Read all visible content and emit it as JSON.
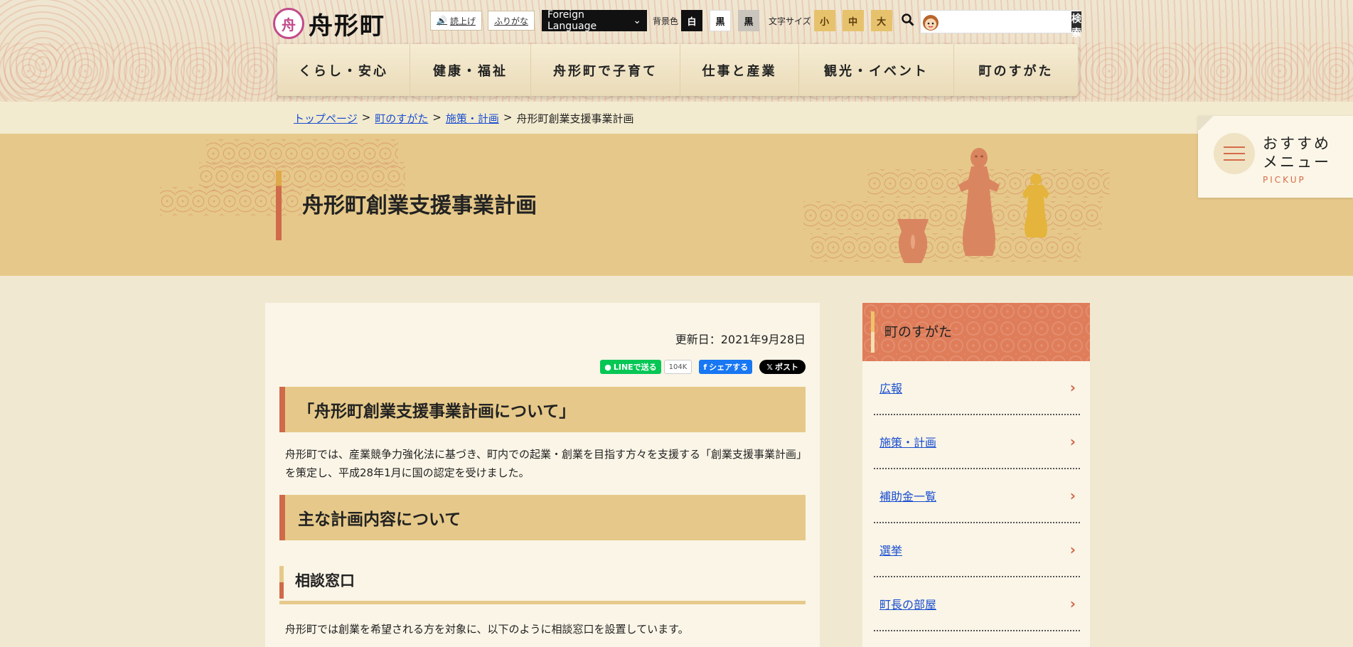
{
  "header": {
    "logo_mark": "舟",
    "logo_text": "舟形町",
    "read_aloud": "読上げ",
    "furigana": "ふりがな",
    "language_select": "Foreign Language",
    "bg_color_label": "背景色",
    "bg_options": [
      "白",
      "黒",
      "黒"
    ],
    "font_size_label": "文字サイズ",
    "font_sizes": [
      "小",
      "中",
      "大"
    ],
    "search_placeholder": "",
    "search_button": "検索"
  },
  "nav": {
    "items": [
      "くらし・安心",
      "健康・福祉",
      "舟形町で子育て",
      "仕事と産業",
      "観光・イベント",
      "町のすがた"
    ]
  },
  "breadcrumb": {
    "items": [
      "トップページ",
      "町のすがた",
      "施策・計画"
    ],
    "current": "舟形町創業支援事業計画",
    "separator": ">"
  },
  "page_title": "舟形町創業支援事業計画",
  "pickup": {
    "line1": "おすすめ",
    "line2": "メニュー",
    "sub": "PICKUP"
  },
  "article": {
    "updated": "更新日：2021年9月28日",
    "share": {
      "line": "LINEで送る",
      "count": "104K",
      "facebook": "シェアする",
      "x": "ポスト"
    },
    "h2_1": "「舟形町創業支援事業計画について」",
    "para_1": "舟形町では、産業競争力強化法に基づき、町内での起業・創業を目指す方々を支援する「創業支援事業計画」を策定し、平成28年1月に国の認定を受けました。",
    "h2_2": "主な計画内容について",
    "h3_1": "相談窓口",
    "para_2": "舟形町では創業を希望される方を対象に、以下のように相談窓口を設置しています。"
  },
  "sidebar": {
    "title": "町のすがた",
    "items": [
      "広報",
      "施策・計画",
      "補助金一覧",
      "選挙",
      "町長の部屋"
    ]
  },
  "colors": {
    "accent_orange": "#d06a4a",
    "band_gold": "#e6c98a",
    "link_blue": "#1a4fd0"
  }
}
